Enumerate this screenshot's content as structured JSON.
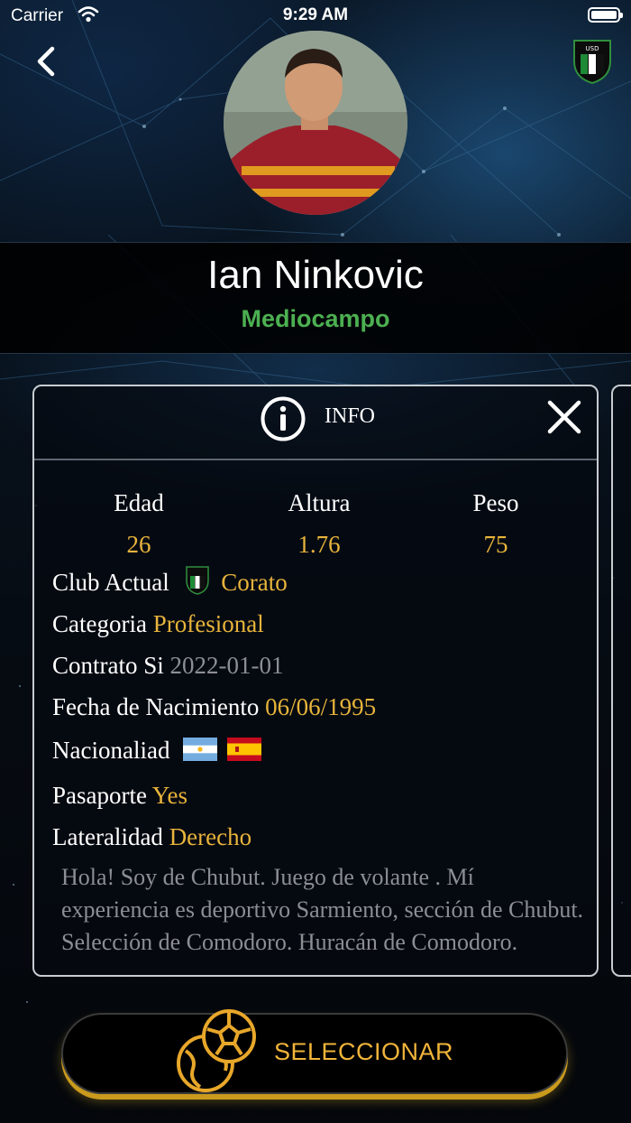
{
  "status_bar": {
    "carrier": "Carrier",
    "time": "9:29 AM"
  },
  "player": {
    "name": "Ian Ninkovic",
    "position": "Mediocampo"
  },
  "info_card": {
    "title": "INFO",
    "stats": [
      {
        "label": "Edad",
        "value": "26"
      },
      {
        "label": "Altura",
        "value": "1.76"
      },
      {
        "label": "Peso",
        "value": "75"
      }
    ],
    "club_label": "Club Actual",
    "club_value": "Corato",
    "category_label": "Categoria",
    "category_value": "Profesional",
    "contract_label": "Contrato",
    "contract_value": "Si",
    "contract_date": "2022-01-01",
    "birth_label": "Fecha de Nacimiento",
    "birth_value": "06/06/1995",
    "nationality_label": "Nacionaliad",
    "nationality_flags": [
      "argentina-flag",
      "spain-flag"
    ],
    "passport_label": "Pasaporte",
    "passport_value": "Yes",
    "laterality_label": "Lateralidad",
    "laterality_value": "Derecho",
    "bio": "Hola! Soy de Chubut. Juego de volante . Mí experiencia es deportivo Sarmiento, sección de Chubut. Selección de Comodoro. Huracán de Comodoro."
  },
  "select_button": {
    "label": "SELECCIONAR",
    "icon": "globe-soccer-ball-icon"
  },
  "colors": {
    "accent_gold": "#e8b43b",
    "position_green": "#4cb051",
    "background": "#05080d"
  }
}
